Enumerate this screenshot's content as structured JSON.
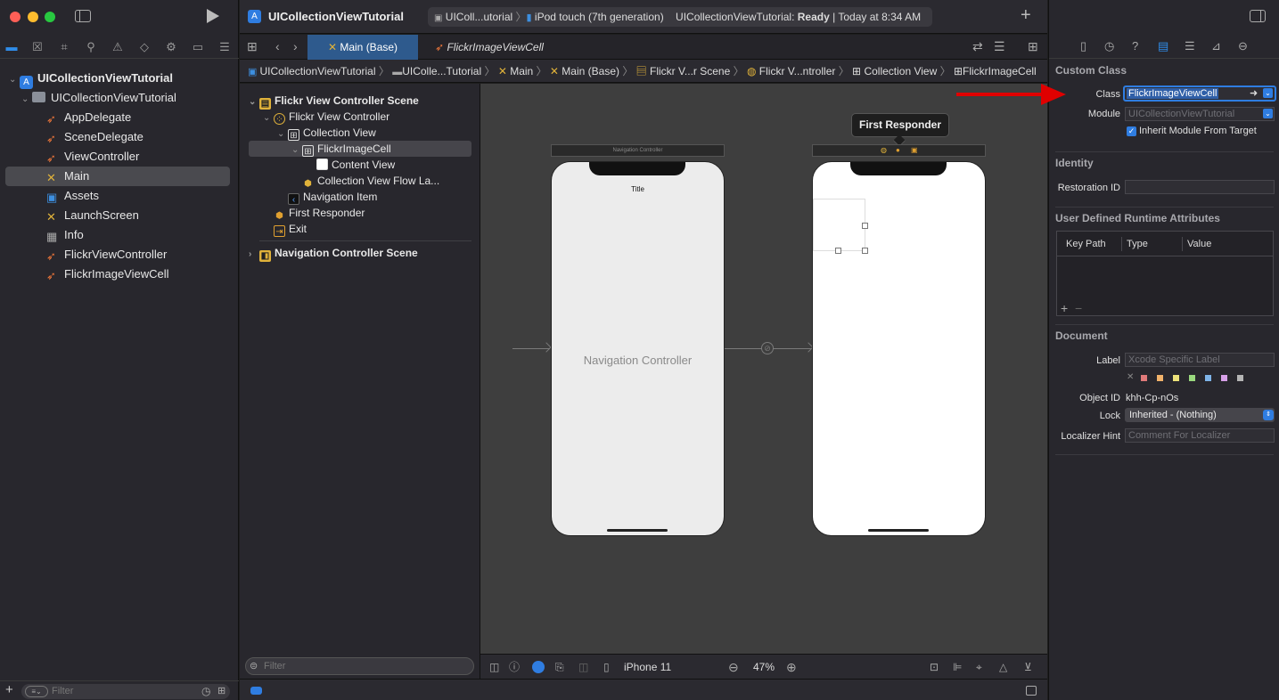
{
  "navigator": {
    "tree": [
      {
        "label": "UICollectionViewTutorial",
        "kind": "project"
      },
      {
        "label": "UICollectionViewTutorial",
        "kind": "folder"
      },
      {
        "label": "AppDelegate",
        "kind": "swift"
      },
      {
        "label": "SceneDelegate",
        "kind": "swift"
      },
      {
        "label": "ViewController",
        "kind": "swift"
      },
      {
        "label": "Main",
        "kind": "storyboard"
      },
      {
        "label": "Assets",
        "kind": "assets"
      },
      {
        "label": "LaunchScreen",
        "kind": "storyboard"
      },
      {
        "label": "Info",
        "kind": "plist"
      },
      {
        "label": "FlickrViewController",
        "kind": "swift"
      },
      {
        "label": "FlickrImageViewCell",
        "kind": "swift"
      }
    ],
    "filter_placeholder": "Filter"
  },
  "toolbar": {
    "project_title": "UICollectionViewTutorial",
    "scheme_target": "UIColl...utorial",
    "device": "iPod touch (7th generation)",
    "status_prefix": "UICollectionViewTutorial: ",
    "status_ready": "Ready",
    "status_time": " | Today at 8:34 AM"
  },
  "tabs": [
    {
      "label": "Main (Base)"
    },
    {
      "label": "FlickrImageViewCell"
    }
  ],
  "jumpbar": [
    "UICollectionViewTutorial",
    "UIColle...Tutorial",
    "Main",
    "Main (Base)",
    "Flickr V...r Scene",
    "Flickr V...ntroller",
    "Collection View",
    "FlickrImageCell"
  ],
  "outline": {
    "rows": [
      {
        "label": "Flickr View Controller Scene"
      },
      {
        "label": "Flickr View Controller"
      },
      {
        "label": "Collection View"
      },
      {
        "label": "FlickrImageCell"
      },
      {
        "label": "Content View"
      },
      {
        "label": "Collection View Flow La..."
      },
      {
        "label": "Navigation Item"
      },
      {
        "label": "First Responder"
      },
      {
        "label": "Exit"
      },
      {
        "label": "Navigation Controller Scene"
      }
    ],
    "filter_placeholder": "Filter"
  },
  "canvas": {
    "nav_scene_bar": "Navigation Controller",
    "nav_title": "Title",
    "nav_label": "Navigation Controller",
    "tooltip": "First Responder"
  },
  "bottombar": {
    "device": "iPhone 11",
    "zoom": "47%"
  },
  "inspector": {
    "custom_class": {
      "title": "Custom Class",
      "class_label": "Class",
      "class_value": "FlickrImageViewCell",
      "module_label": "Module",
      "module_placeholder": "UICollectionViewTutorial",
      "inherit_label": "Inherit Module From Target"
    },
    "identity": {
      "title": "Identity",
      "restoration_label": "Restoration ID"
    },
    "runtime": {
      "title": "User Defined Runtime Attributes",
      "columns": [
        "Key Path",
        "Type",
        "Value"
      ]
    },
    "document": {
      "title": "Document",
      "label_label": "Label",
      "label_placeholder": "Xcode Specific Label",
      "object_id_label": "Object ID",
      "object_id_value": "khh-Cp-nOs",
      "lock_label": "Lock",
      "lock_value": "Inherited - (Nothing)",
      "localizer_label": "Localizer Hint",
      "localizer_placeholder": "Comment For Localizer",
      "swatches": [
        "#e07a7a",
        "#f2b36b",
        "#ede27a",
        "#9ad97e",
        "#7fb4e8",
        "#d7a0e8",
        "#b5b5b5"
      ]
    }
  },
  "colors": {
    "accent": "#2f7de1",
    "arrow": "#e00000"
  }
}
